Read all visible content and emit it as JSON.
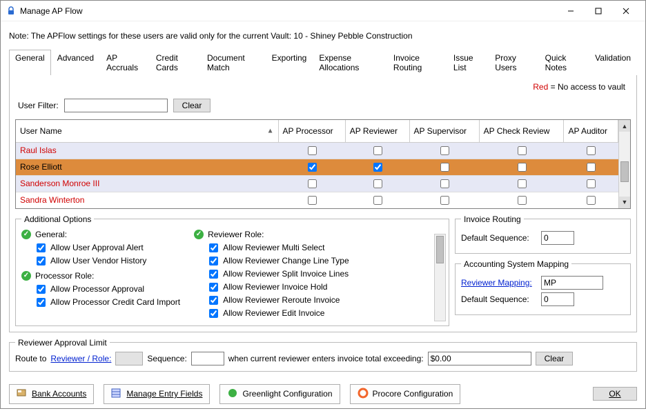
{
  "window": {
    "title": "Manage AP Flow"
  },
  "note": "Note:  The APFlow settings for these users are valid only for the current Vault: 10 - Shiney Pebble Construction",
  "tabs": [
    "General",
    "Advanced",
    "AP Accruals",
    "Credit Cards",
    "Document Match",
    "Exporting",
    "Expense Allocations",
    "Invoice Routing",
    "Issue List",
    "Proxy Users",
    "Quick Notes",
    "Validation"
  ],
  "active_tab": 0,
  "legend": {
    "red_word": "Red",
    "rest": " = No access to vault"
  },
  "filter": {
    "label": "User Filter:",
    "value": "",
    "clear": "Clear"
  },
  "grid": {
    "columns": [
      "User Name",
      "AP Processor",
      "AP Reviewer",
      "AP Supervisor",
      "AP Check Review",
      "AP Auditor"
    ],
    "sort_col": 0,
    "rows": [
      {
        "name": "Raul Islas",
        "noaccess": true,
        "selected": false,
        "checks": [
          false,
          false,
          false,
          false,
          false
        ]
      },
      {
        "name": "Rose Elliott",
        "noaccess": false,
        "selected": true,
        "checks": [
          true,
          true,
          false,
          false,
          false
        ]
      },
      {
        "name": "Sanderson Monroe III",
        "noaccess": true,
        "selected": false,
        "checks": [
          false,
          false,
          false,
          false,
          false
        ]
      },
      {
        "name": "Sandra Winterton",
        "noaccess": true,
        "selected": false,
        "checks": [
          false,
          false,
          false,
          false,
          false
        ]
      }
    ]
  },
  "additional_options": {
    "legend": "Additional Options",
    "general": {
      "heading": "General:",
      "items": [
        "Allow User Approval Alert",
        "Allow User Vendor History"
      ],
      "checked": [
        true,
        true
      ]
    },
    "processor": {
      "heading": "Processor Role:",
      "items": [
        "Allow Processor Approval",
        "Allow Processor Credit Card Import"
      ],
      "checked": [
        true,
        true
      ]
    },
    "reviewer": {
      "heading": "Reviewer Role:",
      "items": [
        "Allow Reviewer Multi Select",
        "Allow Reviewer Change Line Type",
        "Allow Reviewer Split Invoice Lines",
        "Allow Reviewer Invoice Hold",
        "Allow Reviewer Reroute Invoice",
        "Allow Reviewer Edit Invoice"
      ],
      "checked": [
        true,
        true,
        true,
        true,
        true,
        true
      ]
    }
  },
  "invoice_routing": {
    "legend": "Invoice Routing",
    "seq_label": "Default Sequence:",
    "seq_value": "0"
  },
  "accounting_mapping": {
    "legend": "Accounting System Mapping",
    "rm_label": "Reviewer Mapping:",
    "rm_value": "MP",
    "seq_label": "Default Sequence:",
    "seq_value": "0"
  },
  "ral": {
    "legend": "Reviewer Approval Limit",
    "route_to": "Route to",
    "role_link": "Reviewer / Role:",
    "role_value": "",
    "seq_label": "Sequence:",
    "seq_value": "",
    "when_text": "when current reviewer enters invoice total exceeding:",
    "amount": "$0.00",
    "clear": "Clear"
  },
  "bottom": {
    "bank": "Bank Accounts",
    "entry": "Manage Entry Fields",
    "greenlight": "Greenlight Configuration",
    "procore": "Procore Configuration",
    "ok": "OK"
  }
}
